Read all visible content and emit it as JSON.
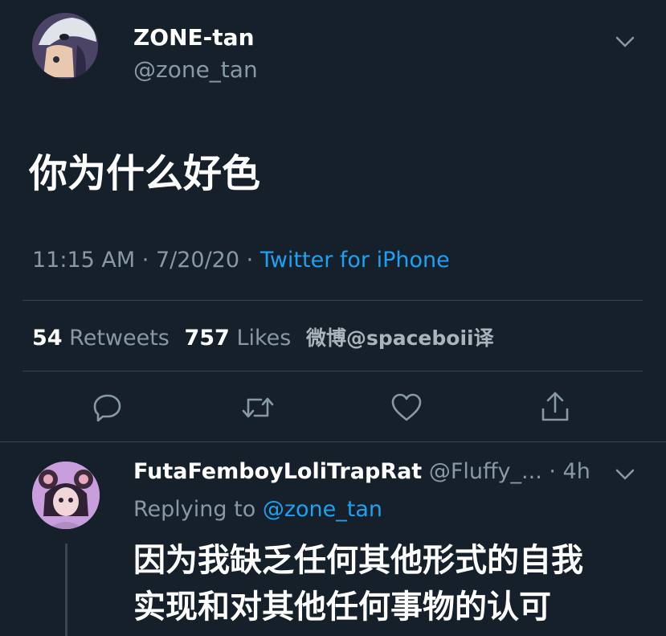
{
  "tweet": {
    "author_name": "ZONE-tan",
    "author_handle": "@zone_tan",
    "text": "你为什么好色",
    "time": "11:15 AM",
    "sep1": "·",
    "date": "7/20/20",
    "sep2": "·",
    "source": "Twitter for iPhone",
    "retweets_count": "54",
    "retweets_label": "Retweets",
    "likes_count": "757",
    "likes_label": "Likes",
    "watermark": "微博@spaceboii译"
  },
  "reply": {
    "author_name": "FutaFemboyLoliTrapRat",
    "author_handle": "@Fluffy_...",
    "time": "· 4h",
    "replying_label": "Replying to",
    "replying_handle": "@zone_tan",
    "text_line1": "因为我缺乏任何其他形式的自我",
    "text_line2": "实现和对其他任何事物的认可"
  },
  "icons": [
    "chevron-down-icon",
    "reply-icon",
    "retweet-icon",
    "like-icon",
    "share-icon"
  ],
  "colors": {
    "background": "#15202b",
    "divider": "#38444d",
    "muted": "#8899a6",
    "accent": "#1da1f2"
  }
}
